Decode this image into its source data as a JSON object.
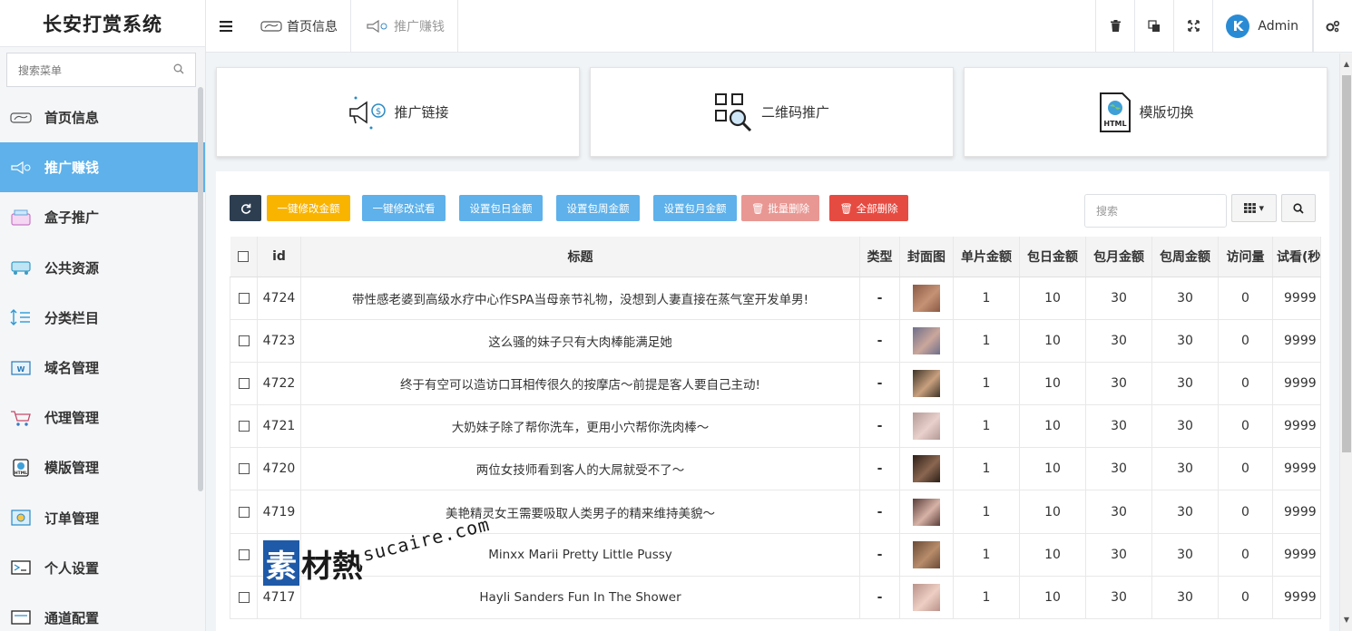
{
  "app": {
    "title": "长安打赏系统"
  },
  "sidebar": {
    "search_placeholder": "搜索菜单",
    "items": [
      {
        "label": "首页信息",
        "icon": "dashboard-icon"
      },
      {
        "label": "推广赚钱",
        "icon": "megaphone-icon",
        "active": true
      },
      {
        "label": "盒子推广",
        "icon": "box-icon"
      },
      {
        "label": "公共资源",
        "icon": "resource-icon"
      },
      {
        "label": "分类栏目",
        "icon": "sort-icon"
      },
      {
        "label": "域名管理",
        "icon": "domain-icon"
      },
      {
        "label": "代理管理",
        "icon": "cart-icon"
      },
      {
        "label": "模版管理",
        "icon": "html-icon"
      },
      {
        "label": "订单管理",
        "icon": "order-icon"
      },
      {
        "label": "个人设置",
        "icon": "settings-icon"
      },
      {
        "label": "通道配置",
        "icon": "channel-icon"
      }
    ]
  },
  "topbar": {
    "tabs": [
      {
        "label": "首页信息"
      },
      {
        "label": "推广赚钱"
      }
    ],
    "user": "Admin",
    "avatar_letter": "K"
  },
  "cards": [
    {
      "label": "推广链接"
    },
    {
      "label": "二维码推广"
    },
    {
      "label": "模版切换"
    }
  ],
  "toolbar": {
    "set_all_amount": "一键修改金额",
    "set_all_trial": "一键修改试看",
    "set_daily": "设置包日金额",
    "set_weekly": "设置包周金额",
    "set_monthly": "设置包月金额",
    "batch_delete": "批量删除",
    "delete_all": "全部删除",
    "search_placeholder": "搜索"
  },
  "table": {
    "headers": [
      "id",
      "标题",
      "类型",
      "封面图",
      "单片金额",
      "包日金额",
      "包月金额",
      "包周金额",
      "访问量",
      "试看(秒"
    ],
    "rows": [
      {
        "id": "4724",
        "title": "带性感老婆到高级水疗中心作SPA当母亲节礼物，没想到人妻直接在蒸气室开发单男!",
        "type": "-",
        "single": "1",
        "daily": "10",
        "monthly": "30",
        "weekly": "30",
        "views": "0",
        "trial": "9999"
      },
      {
        "id": "4723",
        "title": "这么骚的妹子只有大肉棒能满足她",
        "type": "-",
        "single": "1",
        "daily": "10",
        "monthly": "30",
        "weekly": "30",
        "views": "0",
        "trial": "9999"
      },
      {
        "id": "4722",
        "title": "终于有空可以造访口耳相传很久的按摩店～前提是客人要自己主动!",
        "type": "-",
        "single": "1",
        "daily": "10",
        "monthly": "30",
        "weekly": "30",
        "views": "0",
        "trial": "9999"
      },
      {
        "id": "4721",
        "title": "大奶妹子除了帮你洗车，更用小穴帮你洗肉棒～",
        "type": "-",
        "single": "1",
        "daily": "10",
        "monthly": "30",
        "weekly": "30",
        "views": "0",
        "trial": "9999"
      },
      {
        "id": "4720",
        "title": "两位女技师看到客人的大屌就受不了～",
        "type": "-",
        "single": "1",
        "daily": "10",
        "monthly": "30",
        "weekly": "30",
        "views": "0",
        "trial": "9999"
      },
      {
        "id": "4719",
        "title": "美艳精灵女王需要吸取人类男子的精来维持美貌～",
        "type": "-",
        "single": "1",
        "daily": "10",
        "monthly": "30",
        "weekly": "30",
        "views": "0",
        "trial": "9999"
      },
      {
        "id": "",
        "title": "Minxx Marii Pretty Little Pussy",
        "type": "-",
        "single": "1",
        "daily": "10",
        "monthly": "30",
        "weekly": "30",
        "views": "0",
        "trial": "9999"
      },
      {
        "id": "4717",
        "title": "Hayli Sanders Fun In The Shower",
        "type": "-",
        "single": "1",
        "daily": "10",
        "monthly": "30",
        "weekly": "30",
        "views": "0",
        "trial": "9999"
      }
    ]
  },
  "watermark": {
    "char1": "素",
    "chars": "材熱",
    "url": "sucaire.com"
  },
  "colors": {
    "accent": "#5eb1ea",
    "warning": "#f9b400",
    "danger": "#e64b42",
    "dark": "#2c3e50"
  }
}
